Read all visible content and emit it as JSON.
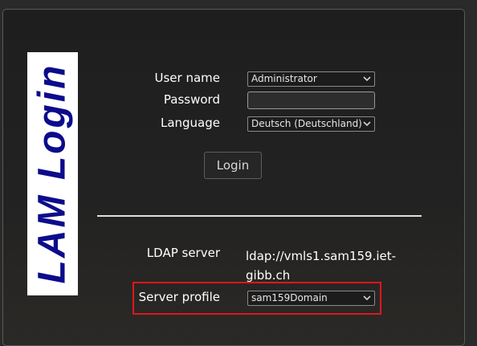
{
  "logo": {
    "text": "LAM Login"
  },
  "form": {
    "username_label": "User name",
    "username_value": "Administrator",
    "password_label": "Password",
    "password_value": "",
    "language_label": "Language",
    "language_value": "Deutsch (Deutschland)",
    "login_button": "Login"
  },
  "server": {
    "ldap_label": "LDAP server",
    "ldap_value": "ldap://vmls1.sam159.iet-gibb.ch",
    "profile_label": "Server profile",
    "profile_value": "sam159Domain"
  },
  "icons": {
    "dropdown": "chevron-down-icon"
  },
  "colors": {
    "logo_text": "#0c0c8c",
    "logo_bg": "#ffffff",
    "highlight_border": "#e0161c",
    "page_bg": "#1e1e1e"
  }
}
